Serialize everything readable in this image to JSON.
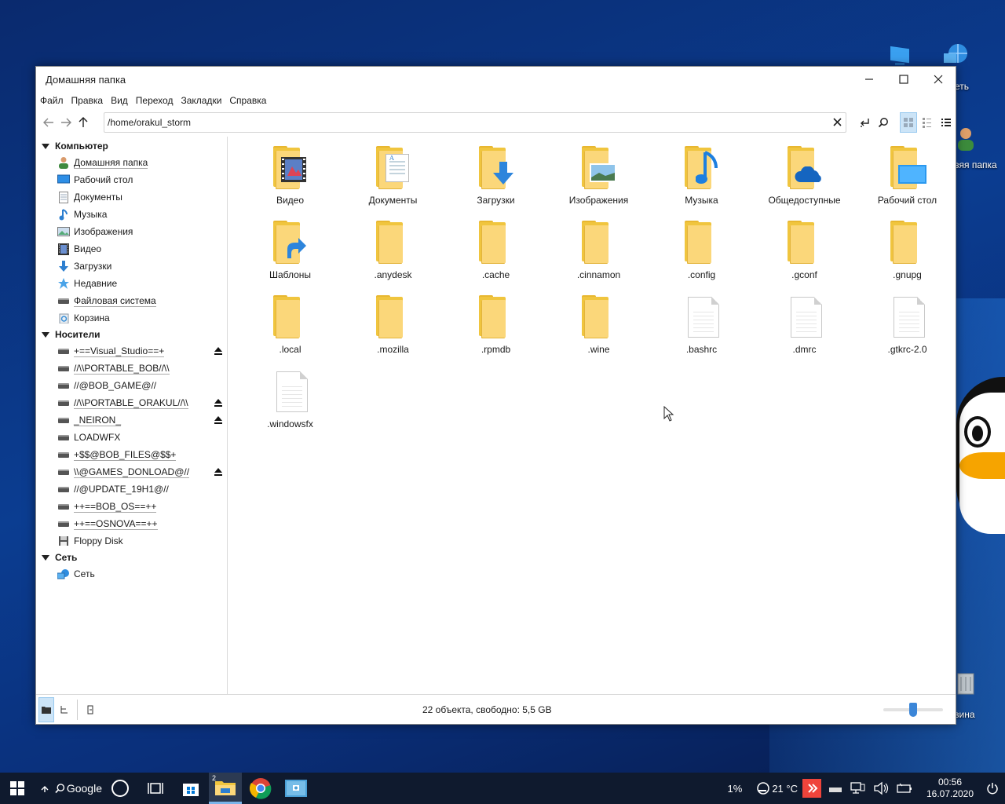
{
  "desktop": {
    "icons": [
      {
        "label": "еть"
      },
      {
        "label": "зяя папка"
      },
      {
        "label": "зина"
      }
    ]
  },
  "window": {
    "title": "Домашняя папка",
    "controls": {
      "minimize": "—",
      "maximize": "☐",
      "close": "✕"
    }
  },
  "menu": [
    "Файл",
    "Правка",
    "Вид",
    "Переход",
    "Закладки",
    "Справка"
  ],
  "toolbar": {
    "path": "/home/orakul_storm",
    "view_mode": "icons"
  },
  "sidebar": {
    "computer": {
      "header": "Компьютер",
      "items": [
        {
          "label": "Домашняя папка",
          "icon": "home-user-icon"
        },
        {
          "label": "Рабочий стол",
          "icon": "desktop-icon"
        },
        {
          "label": "Документы",
          "icon": "documents-icon"
        },
        {
          "label": "Музыка",
          "icon": "music-icon"
        },
        {
          "label": "Изображения",
          "icon": "pictures-icon"
        },
        {
          "label": "Видео",
          "icon": "video-icon"
        },
        {
          "label": "Загрузки",
          "icon": "downloads-icon"
        },
        {
          "label": "Недавние",
          "icon": "recent-icon"
        },
        {
          "label": "Файловая система",
          "icon": "drive-icon"
        },
        {
          "label": "Корзина",
          "icon": "trash-icon"
        }
      ]
    },
    "devices": {
      "header": "Носители",
      "items": [
        {
          "label": "+==Visual_Studio==+",
          "eject": true
        },
        {
          "label": "//\\\\PORTABLE_BOB//\\\\",
          "eject": false
        },
        {
          "label": "//@BOB_GAME@//",
          "eject": false
        },
        {
          "label": "//\\\\PORTABLE_ORAKUL//\\\\",
          "eject": true
        },
        {
          "label": "_NEIRON_",
          "eject": true
        },
        {
          "label": "LOADWFX",
          "eject": false
        },
        {
          "label": "+$$@BOB_FILES@$$+",
          "eject": false
        },
        {
          "label": "\\\\@GAMES_DONLOAD@//",
          "eject": true
        },
        {
          "label": "//@UPDATE_19H1@//",
          "eject": false
        },
        {
          "label": "++==BOB_OS==++",
          "eject": false
        },
        {
          "label": "++==OSNOVA==++",
          "eject": false
        },
        {
          "label": "Floppy Disk",
          "eject": false
        }
      ]
    },
    "network": {
      "header": "Сеть",
      "items": [
        {
          "label": "Сеть",
          "icon": "network-icon"
        }
      ]
    }
  },
  "files": [
    {
      "name": "Видео",
      "kind": "folder",
      "emblem": "video"
    },
    {
      "name": "Документы",
      "kind": "folder",
      "emblem": "documents"
    },
    {
      "name": "Загрузки",
      "kind": "folder",
      "emblem": "downloads"
    },
    {
      "name": "Изображения",
      "kind": "folder",
      "emblem": "pictures"
    },
    {
      "name": "Музыка",
      "kind": "folder",
      "emblem": "music"
    },
    {
      "name": "Общедоступные",
      "kind": "folder",
      "emblem": "cloud"
    },
    {
      "name": "Рабочий стол",
      "kind": "folder",
      "emblem": "desktop"
    },
    {
      "name": "Шаблоны",
      "kind": "folder",
      "emblem": "shortcut"
    },
    {
      "name": ".anydesk",
      "kind": "folder",
      "emblem": ""
    },
    {
      "name": ".cache",
      "kind": "folder",
      "emblem": ""
    },
    {
      "name": ".cinnamon",
      "kind": "folder",
      "emblem": ""
    },
    {
      "name": ".config",
      "kind": "folder",
      "emblem": ""
    },
    {
      "name": ".gconf",
      "kind": "folder",
      "emblem": ""
    },
    {
      "name": ".gnupg",
      "kind": "folder",
      "emblem": ""
    },
    {
      "name": ".local",
      "kind": "folder",
      "emblem": ""
    },
    {
      "name": ".mozilla",
      "kind": "folder",
      "emblem": ""
    },
    {
      "name": ".rpmdb",
      "kind": "folder",
      "emblem": ""
    },
    {
      "name": ".wine",
      "kind": "folder",
      "emblem": ""
    },
    {
      "name": ".bashrc",
      "kind": "file",
      "emblem": ""
    },
    {
      "name": ".dmrc",
      "kind": "file",
      "emblem": ""
    },
    {
      "name": ".gtkrc-2.0",
      "kind": "file",
      "emblem": ""
    },
    {
      "name": ".windowsfx",
      "kind": "file",
      "emblem": ""
    }
  ],
  "statusbar": {
    "text": "22 объекта, свободно: 5,5 GB",
    "zoom_fraction": 0.5
  },
  "taskbar": {
    "search_label": "Google",
    "files_badge": "2",
    "battery": "1%",
    "weather": "21 °C",
    "time": "00:56",
    "date": "16.07.2020"
  },
  "colors": {
    "folder": "#f0c53e",
    "accent": "#3b86d8",
    "taskbar": "#0f1a2e"
  }
}
